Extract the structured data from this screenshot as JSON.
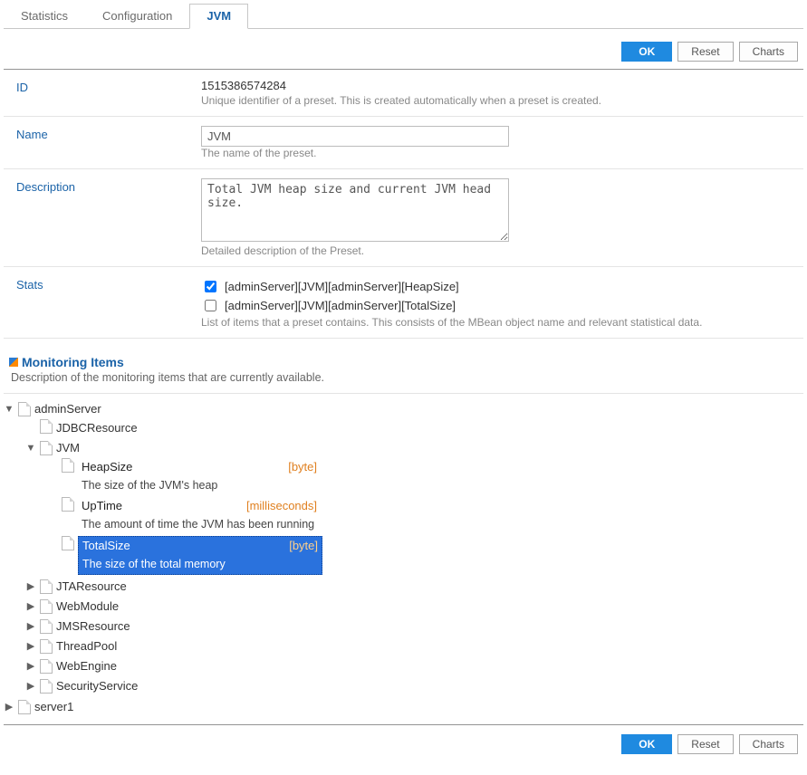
{
  "tabs": [
    {
      "label": "Statistics",
      "active": false
    },
    {
      "label": "Configuration",
      "active": false
    },
    {
      "label": "JVM",
      "active": true
    }
  ],
  "buttons": {
    "ok": "OK",
    "reset": "Reset",
    "charts": "Charts"
  },
  "form": {
    "id": {
      "label": "ID",
      "value": "1515386574284",
      "help": "Unique identifier of a preset. This is created automatically when a preset is created."
    },
    "name": {
      "label": "Name",
      "value": "JVM",
      "help": "The name of the preset."
    },
    "description": {
      "label": "Description",
      "value": "Total JVM heap size and current JVM head size.",
      "help": "Detailed description of the Preset."
    },
    "stats": {
      "label": "Stats",
      "items": [
        {
          "label": "[adminServer][JVM][adminServer][HeapSize]",
          "checked": true
        },
        {
          "label": "[adminServer][JVM][adminServer][TotalSize]",
          "checked": false
        }
      ],
      "help": "List of items that a preset contains. This consists of the MBean object name and relevant statistical data."
    }
  },
  "section": {
    "title": "Monitoring Items",
    "desc": "Description of the monitoring items that are currently available."
  },
  "tree": {
    "adminServer": {
      "label": "adminServer",
      "jdbc": "JDBCResource",
      "jvm": {
        "label": "JVM",
        "heap": {
          "name": "HeapSize",
          "unit": "[byte]",
          "desc": "The size of the JVM's heap"
        },
        "uptime": {
          "name": "UpTime",
          "unit": "[milliseconds]",
          "desc": "The amount of time the JVM has been running"
        },
        "total": {
          "name": "TotalSize",
          "unit": "[byte]",
          "desc": "The size of the total memory"
        }
      },
      "jta": "JTAResource",
      "webmodule": "WebModule",
      "jms": "JMSResource",
      "threadpool": "ThreadPool",
      "webengine": "WebEngine",
      "security": "SecurityService"
    },
    "server1": "server1"
  }
}
